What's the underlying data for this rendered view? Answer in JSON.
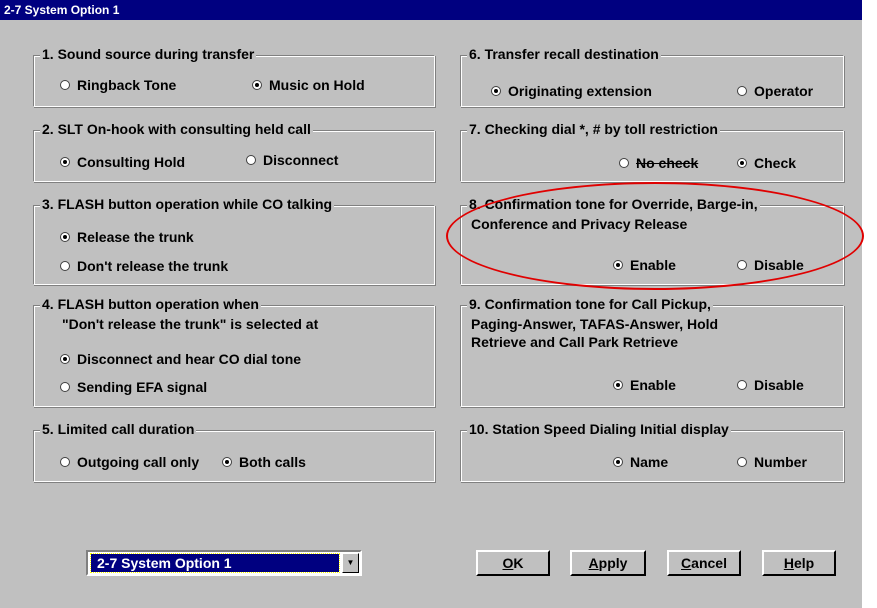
{
  "window": {
    "title": "2-7 System Option 1"
  },
  "groups": {
    "g1": {
      "title": "1. Sound source during transfer",
      "options": [
        {
          "label": "Ringback Tone",
          "selected": false
        },
        {
          "label": "Music on Hold",
          "selected": true
        }
      ]
    },
    "g2": {
      "title": "2. SLT On-hook with consulting held call",
      "options": [
        {
          "label": "Consulting Hold",
          "selected": true
        },
        {
          "label": "Disconnect",
          "selected": false
        }
      ]
    },
    "g3": {
      "title": "3. FLASH button operation while CO talking",
      "options": [
        {
          "label": "Release the trunk",
          "selected": true
        },
        {
          "label": "Don't release the trunk",
          "selected": false
        }
      ]
    },
    "g4": {
      "title": "4. FLASH button operation when",
      "subtitle": "\"Don't release the trunk\" is selected at",
      "options": [
        {
          "label": "Disconnect and hear CO dial tone",
          "selected": true
        },
        {
          "label": "Sending EFA signal",
          "selected": false
        }
      ]
    },
    "g5": {
      "title": "5. Limited call duration",
      "options": [
        {
          "label": "Outgoing call only",
          "selected": false
        },
        {
          "label": "Both calls",
          "selected": true
        }
      ]
    },
    "g6": {
      "title": "6. Transfer recall destination",
      "options": [
        {
          "label": "Originating extension",
          "selected": true
        },
        {
          "label": "Operator",
          "selected": false
        }
      ]
    },
    "g7": {
      "title": "7. Checking dial *, # by toll restriction",
      "options": [
        {
          "label": "No check",
          "selected": false
        },
        {
          "label": "Check",
          "selected": true
        }
      ]
    },
    "g8": {
      "title": "8. Confirmation tone for Override, Barge-in,",
      "subtitle": "Conference and Privacy Release",
      "options": [
        {
          "label": "Enable",
          "selected": true
        },
        {
          "label": "Disable",
          "selected": false
        }
      ]
    },
    "g9": {
      "title": "9. Confirmation tone for Call Pickup,",
      "line2": "Paging-Answer, TAFAS-Answer, Hold",
      "line3": "Retrieve and Call Park Retrieve",
      "options": [
        {
          "label": "Enable",
          "selected": true
        },
        {
          "label": "Disable",
          "selected": false
        }
      ]
    },
    "g10": {
      "title": "10. Station Speed Dialing Initial display",
      "options": [
        {
          "label": "Name",
          "selected": true
        },
        {
          "label": "Number",
          "selected": false
        }
      ]
    }
  },
  "footer": {
    "selector_value": "2-7 System Option 1",
    "ok": {
      "mnemonic": "O",
      "rest": "K"
    },
    "apply": {
      "mnemonic": "A",
      "rest": "pply"
    },
    "cancel": {
      "mnemonic": "C",
      "rest": "ancel"
    },
    "help": {
      "mnemonic": "H",
      "rest": "elp"
    }
  },
  "colors": {
    "window_bg": "#c0c0c0",
    "titlebar": "#000080",
    "highlight": "#e00000"
  }
}
